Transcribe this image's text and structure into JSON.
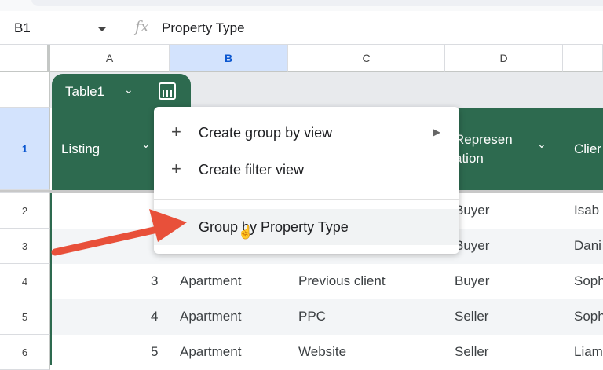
{
  "formula_bar": {
    "cell_ref": "B1",
    "fx": "fx",
    "formula": "Property Type"
  },
  "columns": [
    "A",
    "B",
    "C",
    "D",
    ""
  ],
  "rows": [
    "1",
    "2",
    "3",
    "4",
    "5",
    "6"
  ],
  "table": {
    "name": "Table1",
    "headers": {
      "a": "Listing",
      "d_line1": "Represen",
      "d_line2": "ation",
      "e": "Clier"
    },
    "data": [
      {
        "a": "",
        "b": "",
        "c": "",
        "d": "Buyer",
        "e": "Isab"
      },
      {
        "a": "",
        "b": "",
        "c": "",
        "d": "Buyer",
        "e": "Dani"
      },
      {
        "a": "3",
        "b": "Apartment",
        "c": "Previous client",
        "d": "Buyer",
        "e": "Soph"
      },
      {
        "a": "4",
        "b": "Apartment",
        "c": "PPC",
        "d": "Seller",
        "e": "Soph"
      },
      {
        "a": "5",
        "b": "Apartment",
        "c": "Website",
        "d": "Seller",
        "e": "Liam"
      }
    ]
  },
  "menu": {
    "items": [
      "Create group by view",
      "Create filter view",
      "Group by Property Type"
    ]
  },
  "colors": {
    "table_green": "#2d6a4f",
    "selection": "#d3e3fd",
    "arrow": "#e8503a"
  }
}
